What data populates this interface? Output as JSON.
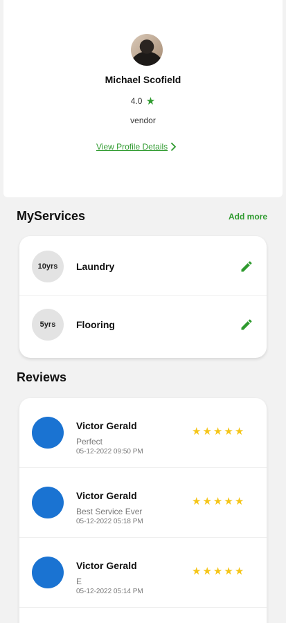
{
  "profile": {
    "name": "Michael Scofield",
    "rating": "4.0",
    "role": "vendor",
    "details_link": "View Profile Details"
  },
  "services_section": {
    "title": "MyServices",
    "add_more": "Add more",
    "items": [
      {
        "years": "10yrs",
        "name": "Laundry"
      },
      {
        "years": "5yrs",
        "name": "Flooring"
      }
    ]
  },
  "reviews_section": {
    "title": "Reviews",
    "items": [
      {
        "name": "Victor Gerald",
        "text": "Perfect",
        "date": "05-12-2022 09:50 PM",
        "stars": 5
      },
      {
        "name": "Victor Gerald",
        "text": "Best Service Ever",
        "date": "05-12-2022 05:18 PM",
        "stars": 5
      },
      {
        "name": "Victor Gerald",
        "text": "E",
        "date": "05-12-2022 05:14 PM",
        "stars": 5
      }
    ]
  },
  "colors": {
    "accent_green": "#2e9a2e",
    "star_yellow": "#f5c518",
    "avatar_blue": "#1a73d2"
  },
  "icons": {
    "rating_star": "star-icon",
    "chevron": "chevron-right-icon",
    "edit": "pencil-icon"
  }
}
